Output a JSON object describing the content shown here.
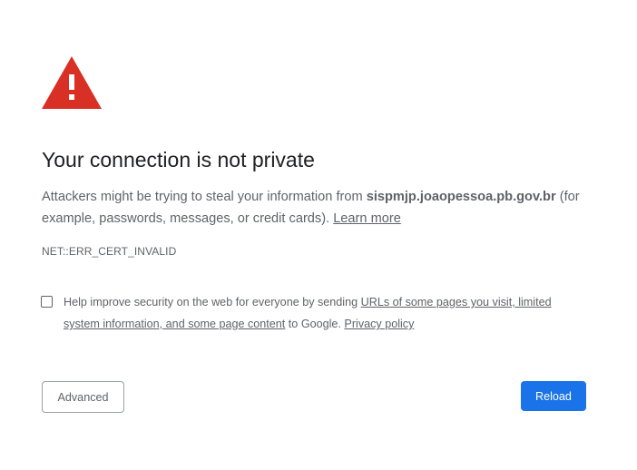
{
  "icon": {
    "name": "warning-triangle-icon",
    "color": "#d93025"
  },
  "heading": "Your connection is not private",
  "explanation": {
    "text_before": "Attackers might be trying to steal your information from ",
    "hostname": "sispmjp.joaopessoa.pb.gov.br",
    "text_after": " (for example, passwords, messages, or credit cards). ",
    "learn_more": "Learn more"
  },
  "error_code": "NET::ERR_CERT_INVALID",
  "optin": {
    "checked": false,
    "text_before": "Help improve security on the web for everyone by sending ",
    "link_text": "URLs of some pages you visit, limited system information, and some page content",
    "text_middle": " to Google. ",
    "privacy_link": "Privacy policy"
  },
  "buttons": {
    "advanced": "Advanced",
    "reload": "Reload"
  },
  "colors": {
    "primary_button": "#1a73e8",
    "text": "#202124",
    "secondary_text": "#5f6368"
  }
}
